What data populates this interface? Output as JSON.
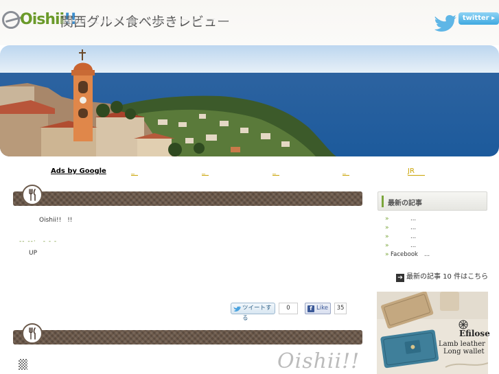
{
  "header": {
    "logo_text": "Oishii",
    "logo_bang": "!!",
    "site_title": "関西グルメ食べ歩きレビュー",
    "twitter_label": "twitter"
  },
  "ads": {
    "ads_by_google": "Ads by Google",
    "links": [
      "_",
      "_",
      "_",
      "_"
    ],
    "jr_link": "JR"
  },
  "post1": {
    "meta": "Oishii!!　!!",
    "dashes": "-- --·　- - -",
    "up": "UP",
    "tweet_label": "ツイートする",
    "tweet_count": "0",
    "like_label": "Like",
    "like_count": "35"
  },
  "sidebar": {
    "heading": "最新の記事",
    "recent_items": [
      {
        "label": "",
        "ellipsis": "..."
      },
      {
        "label": "",
        "ellipsis": "..."
      },
      {
        "label": "",
        "ellipsis": "..."
      },
      {
        "label": "",
        "ellipsis": "..."
      },
      {
        "label": "Facebook",
        "ellipsis": "..."
      }
    ],
    "more_link": "最新の記事 10 件はこちら",
    "ad": {
      "brand": "Efilose",
      "line1": "Lamb leather",
      "line2": "Long wallet"
    }
  },
  "footer_script": "Oishii!!",
  "colors": {
    "accent_green": "#7aa53a",
    "bar_brown": "#5e4d40",
    "link_gold": "#c9a200",
    "twitter_blue": "#3fa9e0"
  }
}
